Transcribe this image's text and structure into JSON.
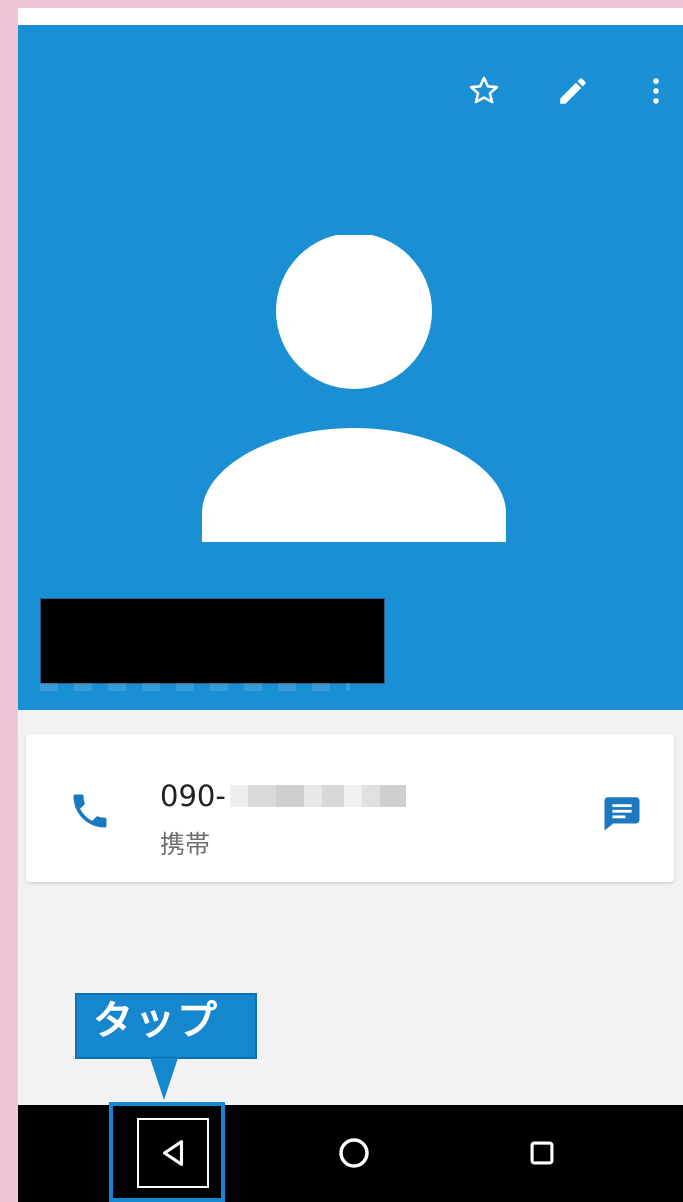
{
  "contact": {
    "phone_prefix": "090-",
    "phone_type_label": "携帯"
  },
  "callout": {
    "label": "タップ"
  },
  "icons": {
    "star": "star-outline-icon",
    "edit": "pencil-icon",
    "more": "more-vert-icon",
    "avatar": "person-avatar-icon",
    "call": "phone-icon",
    "message": "message-icon",
    "back": "back-triangle-icon",
    "home": "home-circle-icon",
    "recents": "recents-square-icon"
  },
  "colors": {
    "header_blue": "#1a8fd3",
    "accent_blue": "#1487cf",
    "page_bg": "#f2f2f2",
    "outer_bg": "#efc6d9",
    "nav_black": "#000000"
  }
}
